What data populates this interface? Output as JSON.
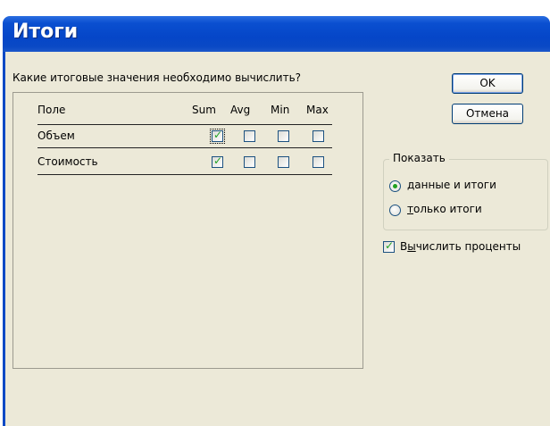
{
  "window": {
    "title": "Итоги"
  },
  "dialog": {
    "prompt": "Какие итоговые значения необходимо вычислить?",
    "table": {
      "columns": [
        "Поле",
        "Sum",
        "Avg",
        "Min",
        "Max"
      ],
      "rows": [
        {
          "field": "Объем",
          "sum": true,
          "avg": false,
          "min": false,
          "max": false
        },
        {
          "field": "Стоимость",
          "sum": true,
          "avg": false,
          "min": false,
          "max": false
        }
      ]
    },
    "buttons": {
      "ok": "OK",
      "cancel": "Отмена"
    },
    "show_group": {
      "title": "Показать",
      "options": [
        {
          "hotkey": "д",
          "rest": "анные и итоги",
          "selected": true
        },
        {
          "hotkey": "т",
          "rest": "олько итоги",
          "selected": false
        }
      ]
    },
    "percent_checkbox": {
      "prefix": "В",
      "hotkey": "ы",
      "rest": "числить проценты",
      "checked": true
    }
  }
}
